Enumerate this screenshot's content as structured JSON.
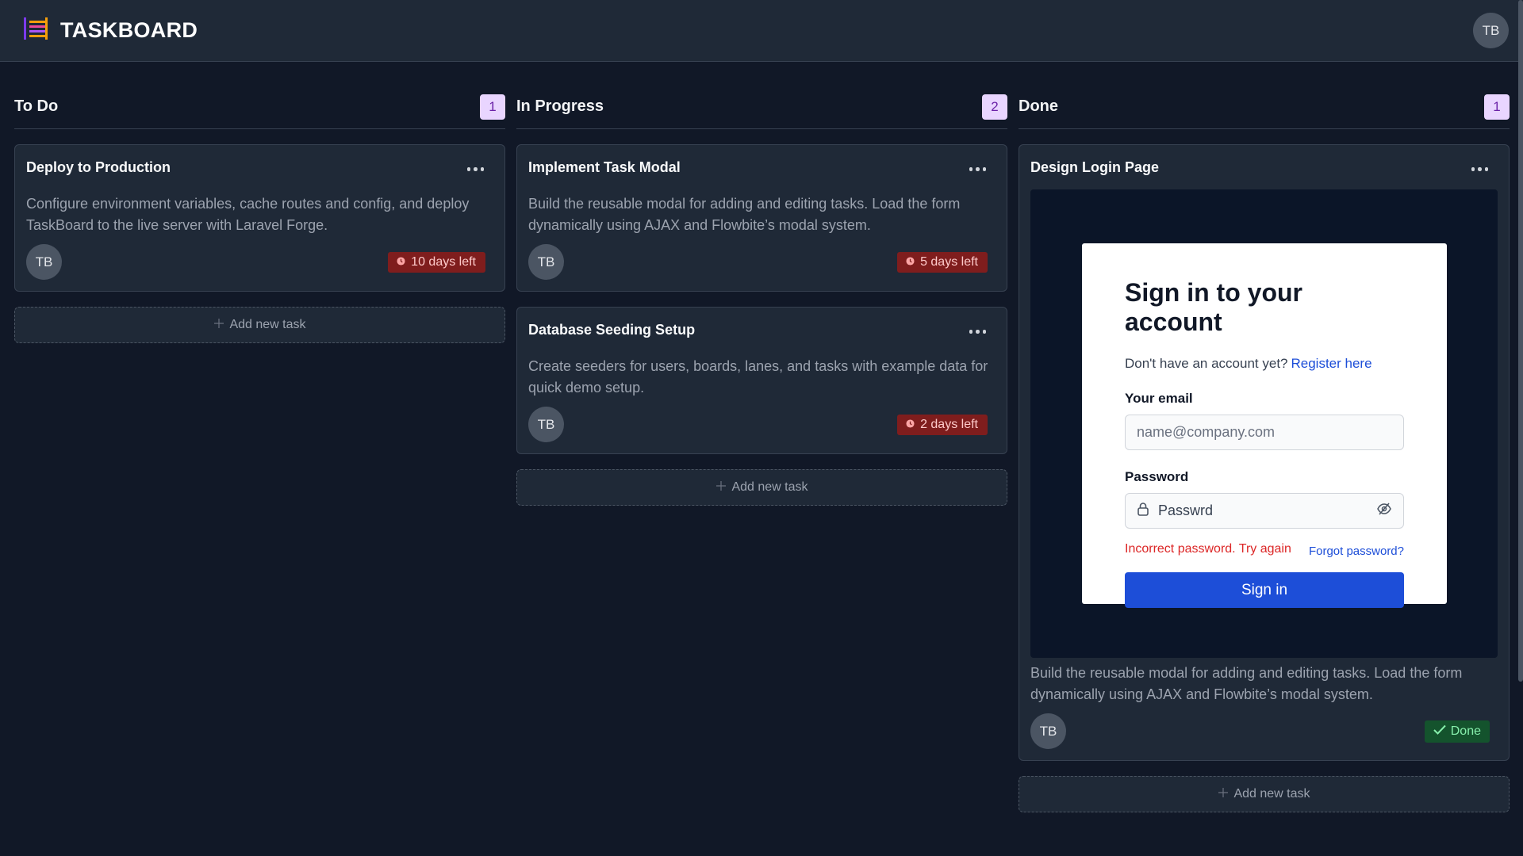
{
  "app": {
    "title": "TASKBOARD",
    "logo_icon": "board-lines-icon",
    "user_initials": "TB"
  },
  "lanes": [
    {
      "title": "To Do",
      "count": "1",
      "cards": [
        {
          "title": "Deploy to Production",
          "desc": "Configure environment variables, cache routes and config, and deploy TaskBoard to the live server with Laravel Forge.",
          "assignee": "TB",
          "status": "10 days left"
        }
      ],
      "add_label": "Add new task"
    },
    {
      "title": "In Progress",
      "count": "2",
      "cards": [
        {
          "title": "Implement Task Modal",
          "desc": "Build the reusable modal for adding and editing tasks. Load the form dynamically using AJAX and Flowbite’s modal system.",
          "assignee": "TB",
          "status": "5 days left"
        },
        {
          "title": "Database Seeding Setup",
          "desc": "Create seeders for users, boards, lanes, and tasks with example data for quick demo setup.",
          "assignee": "TB",
          "status": "2 days left"
        }
      ],
      "add_label": "Add new task"
    },
    {
      "title": "Done",
      "count": "1",
      "cards": [
        {
          "title": "Design Login Page",
          "desc": "Build the reusable modal for adding and editing tasks. Load the form dynamically using AJAX and Flowbite’s modal system.",
          "assignee": "TB",
          "status": "Done"
        }
      ],
      "add_label": "Add new task"
    }
  ],
  "login_preview": {
    "heading": "Sign in to your account",
    "register_prompt": "Don't have an account yet?",
    "register_link": "Register here",
    "email_label": "Your email",
    "email_placeholder": "name@company.com",
    "password_label": "Password",
    "password_value": "Passwrd",
    "error": "Incorrect password. Try again",
    "forgot": "Forgot password?",
    "submit": "Sign in"
  },
  "colors": {
    "bg": "#111827",
    "card": "#1f2937",
    "count_badge": "#e9d5ff",
    "due_badge": "#7f1d1d",
    "done_badge": "#14532d",
    "primary": "#1d4ed8"
  }
}
